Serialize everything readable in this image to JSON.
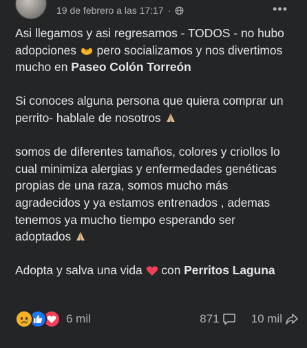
{
  "post": {
    "timestamp": "19 de febrero a las 17:17",
    "separator": "·",
    "privacy_icon": "globe-icon",
    "more_icon": "more-options-icon",
    "paragraphs": {
      "p1_a": "Asi llegamos y asi regresamos - TODOS - no hubo adopciones ",
      "p1_b": " pero socializamos y nos divertimos mucho en ",
      "p1_bold": "Paseo Colón Torreón",
      "p2_a": "Si conoces alguna persona que quiera comprar un perrito- hablale de nosotros ",
      "p3_a": "somos de diferentes tamaños, colores y criollos lo cual minimiza alergias y enfermedades genéticas propias de una raza, somos mucho más agradecidos y ya estamos entrenados , ademas tenemos ya mucho tiempo esperando ser adoptados ",
      "p4_a": "Adopta y salva una vida ",
      "p4_b": " con ",
      "p4_bold": "Perritos Laguna"
    }
  },
  "reactions": {
    "icons": [
      "sad-reaction-icon",
      "like-reaction-icon",
      "love-reaction-icon"
    ],
    "count": "6 mil"
  },
  "stats": {
    "comments": "871",
    "shares": "10 mil"
  },
  "colors": {
    "background": "#242526",
    "text": "#e4e6eb",
    "secondary": "#b0b3b8",
    "like": "#1877f2",
    "love": "#f33e58",
    "sad": "#f7b125"
  }
}
